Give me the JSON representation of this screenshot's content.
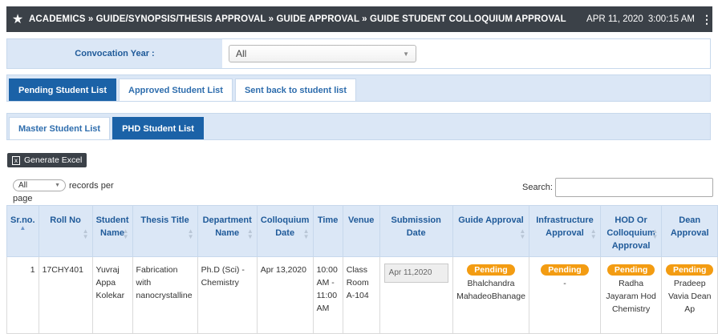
{
  "header": {
    "breadcrumb": "ACADEMICS » GUIDE/SYNOPSIS/THESIS APPROVAL » GUIDE APPROVAL » GUIDE STUDENT COLLOQUIUM APPROVAL",
    "date": "APR 11, 2020",
    "time": "3:00:15 AM",
    "star_icon": "★",
    "menu_icon": "⋮"
  },
  "filter": {
    "label": "Convocation Year :",
    "value": "All"
  },
  "tabs_primary": [
    "Pending Student List",
    "Approved Student List",
    "Sent back to student list"
  ],
  "tabs_secondary": [
    "Master Student List",
    "PHD Student List"
  ],
  "toolbar": {
    "excel_label": "Generate Excel",
    "records_value": "All",
    "records_label": "records per",
    "records_label2": "page",
    "search_label": "Search:"
  },
  "table": {
    "headers": [
      "Sr.no.",
      "Roll No",
      "Student Name",
      "Thesis Title",
      "Department Name",
      "Colloquium Date",
      "Time",
      "Venue",
      "Submission Date",
      "Guide Approval",
      "Infrastructure Approval",
      "HOD Or Colloquium Approval",
      "Dean Approval"
    ],
    "row": {
      "srno": "1",
      "roll": "17CHY401",
      "name": "Yuvraj Appa Kolekar",
      "thesis": "Fabrication with nanocrystalline",
      "dept": "Ph.D (Sci) - Chemistry",
      "colloquium_date": "Apr 13,2020",
      "time": "10:00 AM - 11:00 AM",
      "venue": "Class Room A-104",
      "submission_date": "Apr 11,2020",
      "guide_status": "Pending",
      "guide_name": "Bhalchandra MahadeoBhanage",
      "infra_status": "Pending",
      "infra_name": "-",
      "hod_status": "Pending",
      "hod_name": "Radha Jayaram Hod Chemistry",
      "dean_status": "Pending",
      "dean_name": "Pradeep Vavia Dean Ap"
    }
  },
  "colors": {
    "header_bg": "#3b4148",
    "accent": "#1b62a7",
    "light_blue": "#dbe7f6",
    "badge": "#f39c12"
  }
}
